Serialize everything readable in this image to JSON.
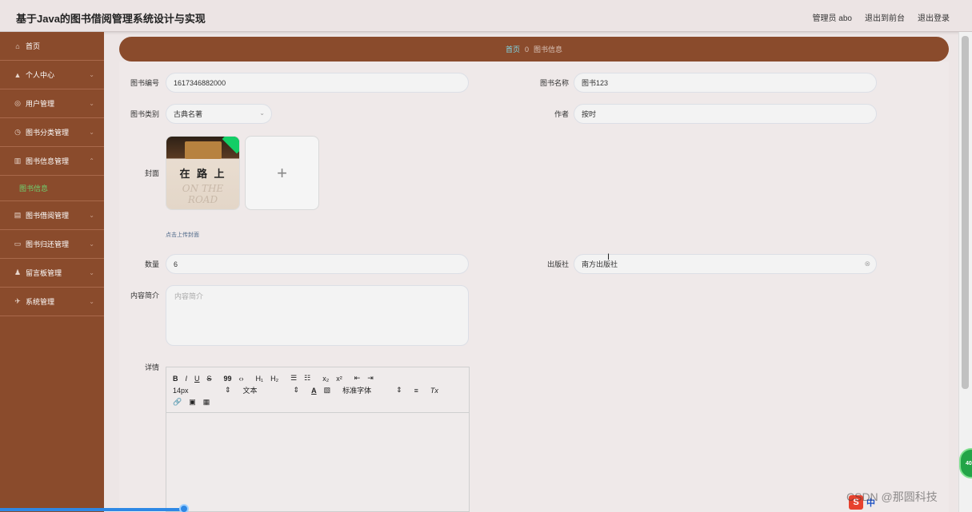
{
  "header": {
    "title": "基于Java的图书借阅管理系统设计与实现",
    "admin": "管理员 abo",
    "back_front": "退出到前台",
    "logout": "退出登录"
  },
  "sidebar": {
    "items": [
      {
        "icon": "home-icon",
        "glyph": "⌂",
        "label": "首页",
        "has_chevron": false
      },
      {
        "icon": "user-icon",
        "glyph": "▲",
        "label": "个人中心",
        "has_chevron": true
      },
      {
        "icon": "users-icon",
        "glyph": "◎",
        "label": "用户管理",
        "has_chevron": true
      },
      {
        "icon": "clock-icon",
        "glyph": "◷",
        "label": "图书分类管理",
        "has_chevron": true
      },
      {
        "icon": "chart-icon",
        "glyph": "▥",
        "label": "图书信息管理",
        "has_chevron": true
      }
    ],
    "active_sub": "图书信息",
    "items_after": [
      {
        "icon": "book-icon",
        "glyph": "▤",
        "label": "图书借阅管理",
        "has_chevron": true
      },
      {
        "icon": "card-icon",
        "glyph": "▭",
        "label": "图书归还管理",
        "has_chevron": true
      },
      {
        "icon": "person-icon",
        "glyph": "♟",
        "label": "留言板管理",
        "has_chevron": true
      },
      {
        "icon": "send-icon",
        "glyph": "✈",
        "label": "系统管理",
        "has_chevron": true
      }
    ]
  },
  "breadcrumb": {
    "home": "首页",
    "sep": "0",
    "current": "图书信息"
  },
  "form": {
    "book_no_label": "图书编号",
    "book_no_value": "1617346882000",
    "book_name_label": "图书名称",
    "book_name_value": "图书123",
    "category_label": "图书类别",
    "category_value": "古典名著",
    "author_label": "作者",
    "author_value": "按时",
    "cover_label": "封面",
    "cover_title": "在 路 上",
    "cover_subtitle": "ON THE ROAD",
    "upload_glyph": "+",
    "upload_hint": "点击上传封面",
    "quantity_label": "数量",
    "quantity_value": "6",
    "publisher_label": "出版社",
    "publisher_value": "南方出版社",
    "intro_label": "内容简介",
    "intro_placeholder": "内容简介",
    "detail_label": "详情"
  },
  "editor": {
    "row1": [
      "B",
      "I",
      "U",
      "S",
      "99",
      "‹›",
      "H₁",
      "H₂",
      "☰",
      "☷",
      "x₂",
      "x²",
      "⇤",
      "⇥"
    ],
    "font_size": "14px",
    "text_style": "文本",
    "font_color": "A",
    "bg_color": "▧",
    "font_family": "标准字体",
    "align": "≡",
    "clear": "Tx",
    "row3": [
      "🔗",
      "▣",
      "▦"
    ]
  },
  "overlay": {
    "float_badge": "40",
    "watermark": "CSDN @那圆科技",
    "ime_label": "中"
  }
}
